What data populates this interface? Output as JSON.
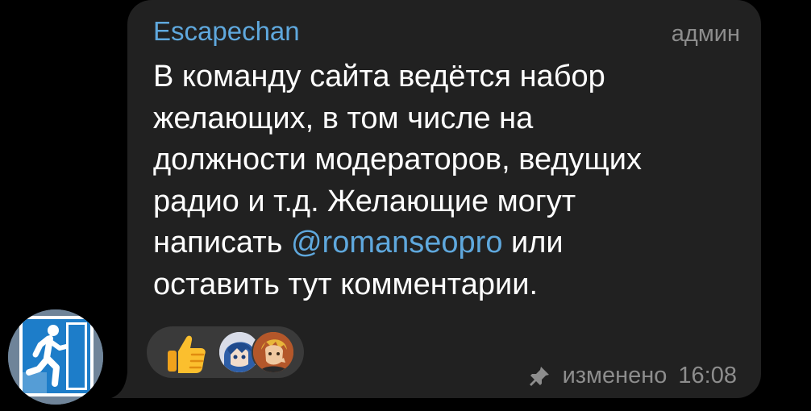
{
  "message": {
    "sender": "Escapechan",
    "role": "админ",
    "lines": [
      "В команду сайта ведётся набор",
      "желающих, в том числе на",
      "должности модераторов, ведущих",
      "радио и т.д. Желающие могут"
    ],
    "line5_before": "написать ",
    "mention": "@romanseopro",
    "line5_after": " или",
    "line6": "оставить тут комментарии.",
    "status": "изменено",
    "time": "16:08"
  },
  "reactions": {
    "emoji_icon": "thumbs-up-icon",
    "participants": [
      "reaction-avatar-1",
      "reaction-avatar-2"
    ]
  },
  "colors": {
    "background": "#000000",
    "bubble": "#212121",
    "accent": "#5fa8dd",
    "muted": "#8d8d8d",
    "text": "#ffffff"
  }
}
